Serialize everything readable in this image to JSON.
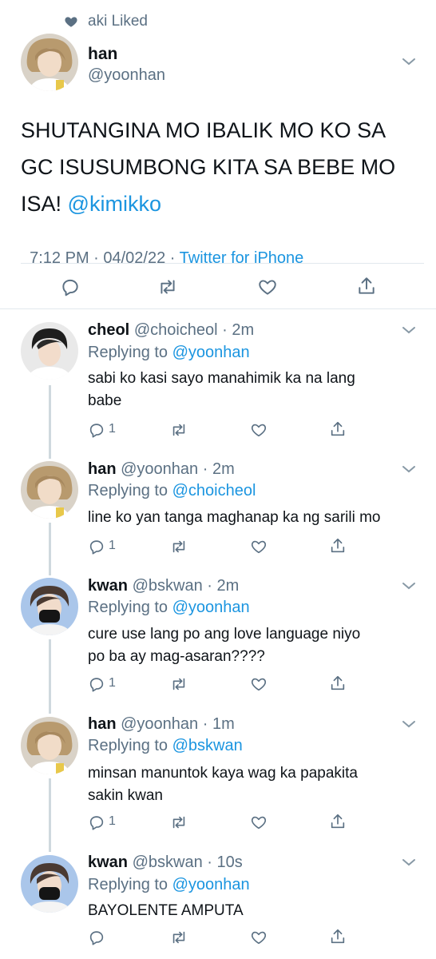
{
  "liked_banner": {
    "text": "aki Liked",
    "icon": "heart-icon"
  },
  "main_tweet": {
    "name": "han",
    "handle": "@yoonhan",
    "text": "SHUTANGINA MO IBALIK MO KO SA GC ISUSUMBONG KITA SA BEBE MO ISA!",
    "mention": "@kimikko",
    "time": "7:12 PM · 04/02/22 · ",
    "source": "Twitter for iPhone"
  },
  "replies": [
    {
      "name": "cheol",
      "handle": "@choicheol · 2m",
      "replying_prefix": "Replying to",
      "replying_to": "@yoonhan",
      "lines": [
        "sabi ko kasi sayo manahimik ka na lang",
        "babe"
      ],
      "reply_count": "1"
    },
    {
      "name": "han",
      "handle": "@yoonhan · 2m",
      "replying_prefix": "Replying to",
      "replying_to": "@choicheol",
      "lines": [
        "line ko yan tanga maghanap ka ng sarili mo"
      ],
      "reply_count": "1"
    },
    {
      "name": "kwan",
      "handle": "@bskwan · 2m",
      "replying_prefix": "Replying to",
      "replying_to": "@yoonhan",
      "lines": [
        "cure use lang po ang love language niyo",
        "po ba ay mag-asaran????"
      ],
      "reply_count": "1"
    },
    {
      "name": "han",
      "handle": "@yoonhan · 1m",
      "replying_prefix": "Replying to",
      "replying_to": "@bskwan",
      "lines": [
        "minsan manuntok kaya wag ka papakita",
        "sakin kwan"
      ],
      "reply_count": "1"
    },
    {
      "name": "kwan",
      "handle": "@bskwan · 10s",
      "replying_prefix": "Replying to",
      "replying_to": "@yoonhan",
      "lines": [
        "BAYOLENTE AMPUTA"
      ],
      "reply_count": ""
    }
  ],
  "colors": {
    "link": "#1b95e0",
    "secondary": "#5b7083",
    "divider": "#e1e8ed"
  }
}
